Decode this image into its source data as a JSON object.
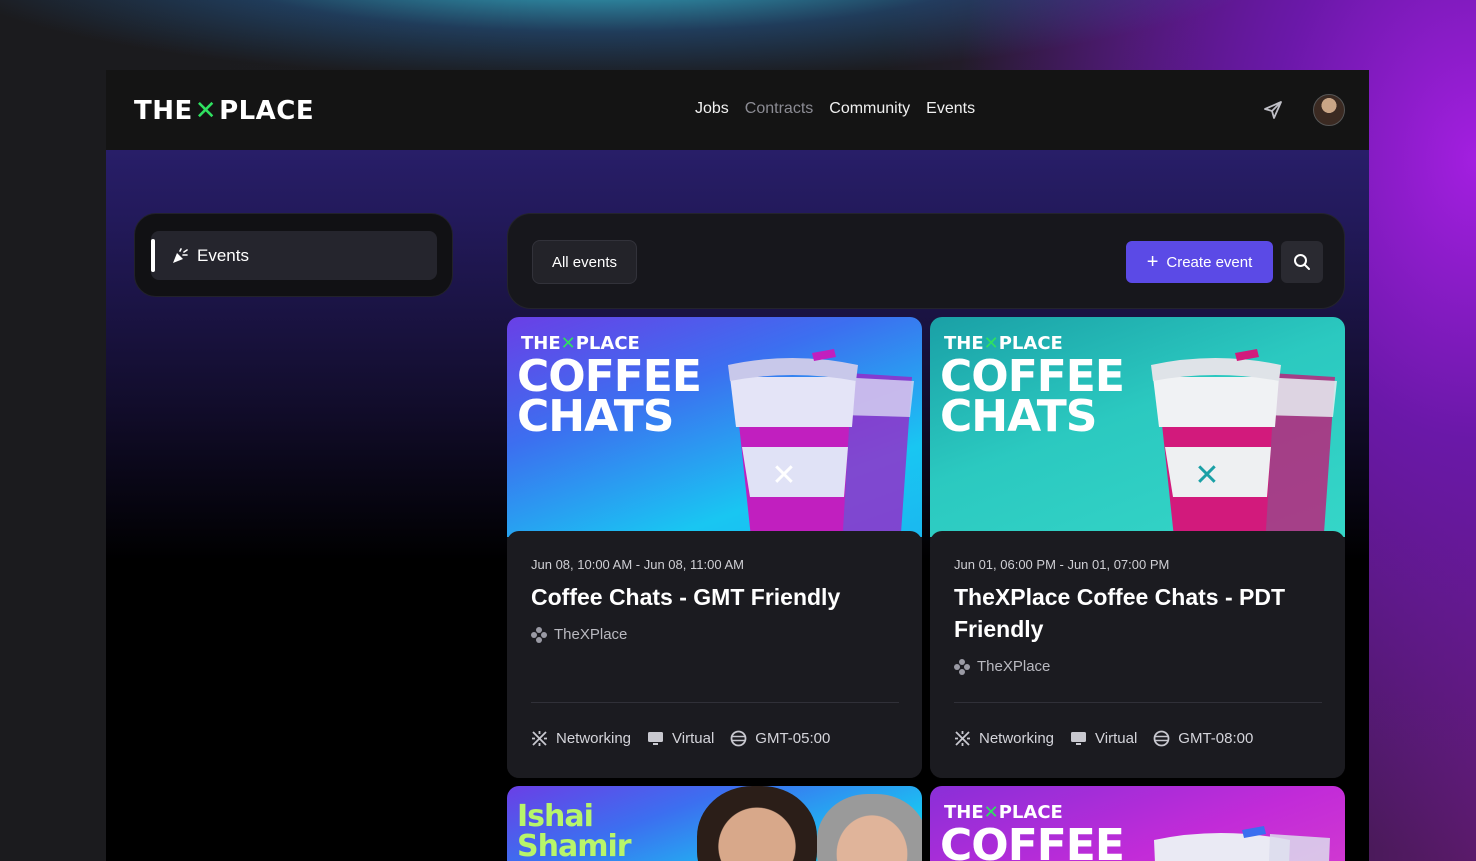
{
  "brand": {
    "logo_left": "THE",
    "logo_mark": "✕",
    "logo_right": "PLACE",
    "accent": "#2fe060",
    "primary": "#5b4ae6"
  },
  "nav": {
    "items": [
      {
        "label": "Jobs",
        "active": true
      },
      {
        "label": "Contracts",
        "active": false
      },
      {
        "label": "Community",
        "active": true
      },
      {
        "label": "Events",
        "active": true
      }
    ]
  },
  "sidebar": {
    "items": [
      {
        "label": "Events",
        "icon": "party-popper-icon"
      }
    ]
  },
  "toolbar": {
    "filter_label": "All events",
    "create_label": "Create event",
    "create_icon": "plus-icon",
    "search_icon": "search-icon"
  },
  "events": [
    {
      "banner": {
        "logo": "THE",
        "logo_right": "PLACE",
        "headline_1": "COFFEE",
        "headline_2": "CHATS",
        "style": "blue"
      },
      "date": "Jun 08, 10:00 AM - Jun 08, 11:00 AM",
      "title": "Coffee Chats - GMT Friendly",
      "organizer": "TheXPlace",
      "tags": [
        "Networking",
        "Virtual",
        "GMT-05:00"
      ]
    },
    {
      "banner": {
        "logo": "THE",
        "logo_right": "PLACE",
        "headline_1": "COFFEE",
        "headline_2": "CHATS",
        "style": "teal"
      },
      "date": "Jun 01, 06:00 PM - Jun 01, 07:00 PM",
      "title": "TheXPlace Coffee Chats - PDT Friendly",
      "organizer": "TheXPlace",
      "tags": [
        "Networking",
        "Virtual",
        "GMT-08:00"
      ]
    },
    {
      "banner": {
        "headline_1": "Ishai",
        "headline_2": "Shamir",
        "style": "blue"
      }
    },
    {
      "banner": {
        "logo": "THE",
        "logo_right": "PLACE",
        "headline_1": "COFFEE",
        "style": "purple"
      }
    }
  ]
}
